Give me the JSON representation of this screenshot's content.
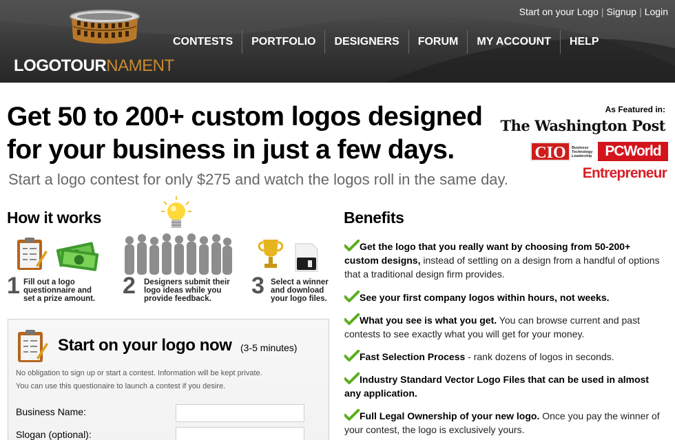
{
  "header": {
    "logo_main": "LOGOTOUR",
    "logo_accent": "NAMENT",
    "top_links": [
      "Start on your Logo",
      "Signup",
      "Login"
    ],
    "nav": [
      "CONTESTS",
      "PORTFOLIO",
      "DESIGNERS",
      "FORUM",
      "MY ACCOUNT",
      "HELP"
    ]
  },
  "hero": {
    "title_line1": "Get 50 to 200+ custom logos designed",
    "title_line2": "for your business in just a few days.",
    "subtitle": "Start a logo contest for only $275 and watch the logos roll in the same day."
  },
  "featured": {
    "label": "As Featured in:",
    "washington_post": "The Washington Post",
    "cio": "CIO",
    "cio_sub": [
      "Business",
      "Technology",
      "Leadership"
    ],
    "pcworld": "PCWorld",
    "entrepreneur": "Entrepreneur"
  },
  "how_it_works": {
    "title": "How it works",
    "steps": [
      {
        "num": "1",
        "text": [
          "Fill out a logo",
          "questionnaire and",
          "set a prize amount."
        ]
      },
      {
        "num": "2",
        "text": [
          "Designers submit their",
          "logo ideas while you",
          "provide feedback."
        ]
      },
      {
        "num": "3",
        "text": [
          "Select a winner",
          "and download",
          "your logo files."
        ]
      }
    ]
  },
  "form": {
    "title": "Start on your logo now",
    "time": "(3-5 minutes)",
    "note1": "No obligation to sign up or start a contest. Information will be kept private.",
    "note2": "You can use this questionaire to launch a contest if you desire.",
    "fields": [
      {
        "label": "Business Name:",
        "value": ""
      },
      {
        "label": "Slogan (optional):",
        "value": ""
      }
    ]
  },
  "benefits": {
    "title": "Benefits",
    "items": [
      {
        "bold": "Get the logo that you really want by choosing from 50-200+ custom designs,",
        "rest": " instead of settling on a design from a handful of options that a traditional design firm provides."
      },
      {
        "bold": "See your first company logos within hours, not weeks.",
        "rest": ""
      },
      {
        "bold": "What you see is what you get.",
        "rest": " You can browse current and past contests to see exactly what you will get for your money."
      },
      {
        "bold": "Fast Selection Process",
        "rest": " - rank dozens of logos in seconds."
      },
      {
        "bold": "Industry Standard Vector Logo Files that can be used in almost any application.",
        "rest": ""
      },
      {
        "bold": "Full Legal Ownership of your new logo.",
        "rest": " Once you pay the winner of your contest, the logo is exclusively yours."
      }
    ]
  },
  "colors": {
    "header_dark": "#2a2a2a",
    "logo_gold": "#c98a2f",
    "check_green": "#5cae1f",
    "cio_red": "#cf1d1d",
    "pcworld_red": "#d4141c",
    "entrepreneur_red": "#d61f26"
  },
  "icons": [
    "colosseum-logo-icon",
    "clipboard-icon",
    "money-icon",
    "lightbulb-icon",
    "crowd-icon",
    "trophy-icon",
    "floppy-disk-icon",
    "checkmark-icon"
  ]
}
